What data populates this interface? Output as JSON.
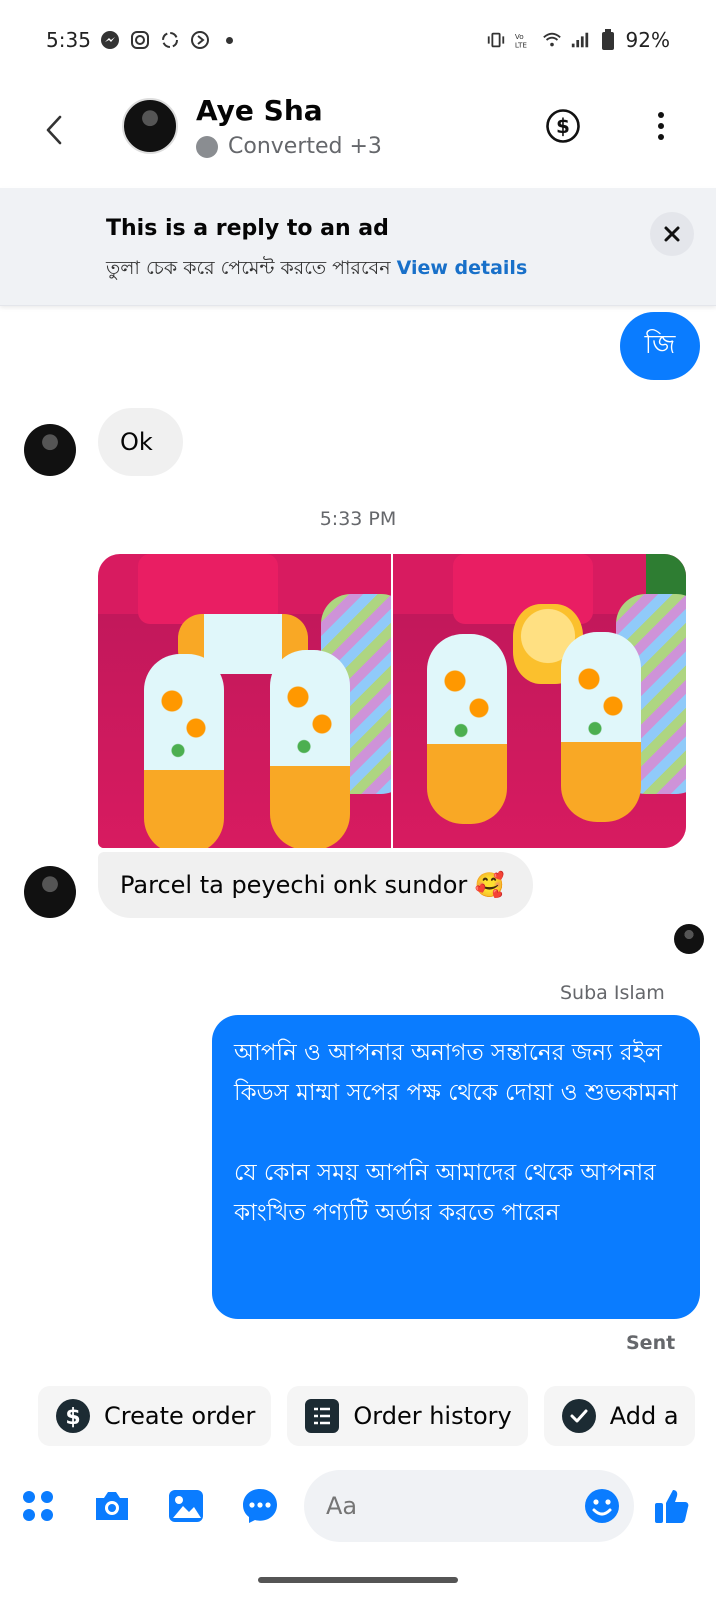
{
  "status_bar": {
    "time": "5:35",
    "battery": "92%",
    "network": "VoLTE"
  },
  "header": {
    "contact_name": "Aye Sha",
    "status_text": "Converted +3",
    "icons": [
      "back-arrow-icon",
      "dollar-icon",
      "more-vertical-icon"
    ]
  },
  "ad_banner": {
    "title": "This is a reply to an ad",
    "subtitle": "তুলা চেক করে  পেমেন্ট  করতে পারবেন",
    "link": "View details"
  },
  "messages": {
    "sent_short": "জি",
    "recv_ok": "Ok",
    "timestamp": "5:33 PM",
    "recv_parcel": "Parcel ta peyechi onk sundor 🥰",
    "sender_name": "Suba Islam",
    "sent_long_p1": "আপনি ও আপনার অনাগত সন্তানের জন্য রইল কিডস মাম্মা সপের পক্ষ থেকে দোয়া ও শুভকামনা",
    "sent_long_p2": "যে কোন সময় আপনি আমাদের থেকে আপনার কাংখিত পণ্যটি অর্ডার করতে পারেন",
    "sent_status": "Sent"
  },
  "quick_actions": {
    "create_order": "Create order",
    "order_history": "Order history",
    "add": "Add a"
  },
  "composer": {
    "placeholder": "Aa"
  },
  "colors": {
    "accent": "#0a7cff",
    "link": "#1870c9",
    "bubble_received": "#f0f0f0"
  }
}
